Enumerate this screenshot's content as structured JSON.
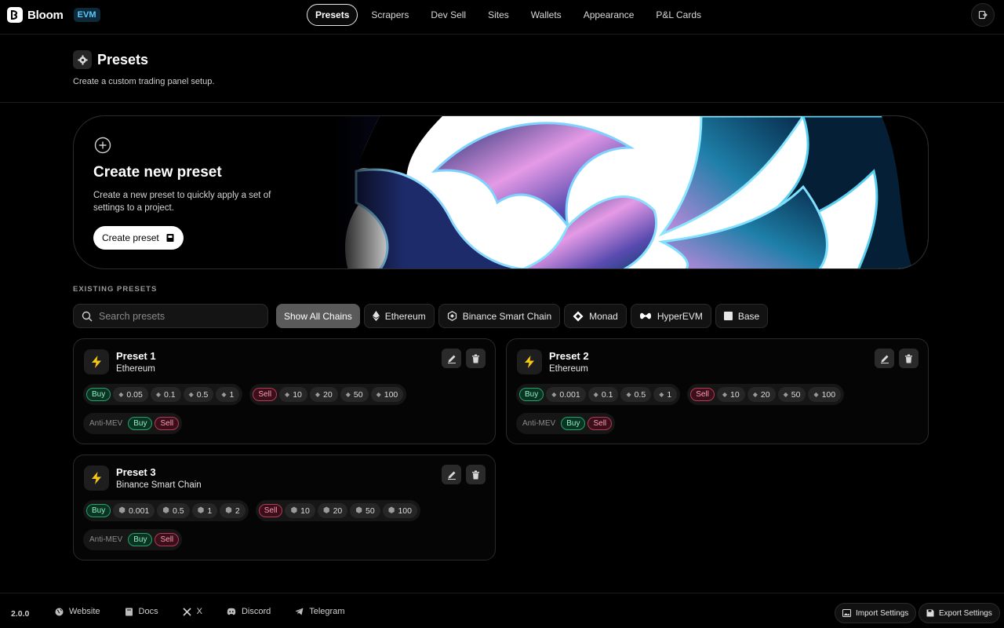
{
  "app": {
    "name": "Bloom",
    "badge": "EVM"
  },
  "nav": [
    "Presets",
    "Scrapers",
    "Dev Sell",
    "Sites",
    "Wallets",
    "Appearance",
    "P&L Cards"
  ],
  "page": {
    "title": "Presets",
    "subtitle": "Create a custom trading panel setup."
  },
  "hero": {
    "title": "Create new preset",
    "description": "Create a new preset to quickly apply a set of settings to a project.",
    "button": "Create preset"
  },
  "existing": {
    "label": "EXISTING PRESETS",
    "search_placeholder": "Search presets",
    "chains": [
      "Show All Chains",
      "Ethereum",
      "Binance Smart Chain",
      "Monad",
      "HyperEVM",
      "Base"
    ]
  },
  "presets": [
    {
      "name": "Preset 1",
      "chain": "Ethereum",
      "buy": [
        "0.05",
        "0.1",
        "0.5",
        "1"
      ],
      "sell": [
        "10",
        "20",
        "50",
        "100"
      ]
    },
    {
      "name": "Preset 2",
      "chain": "Ethereum",
      "buy": [
        "0.001",
        "0.1",
        "0.5",
        "1"
      ],
      "sell": [
        "10",
        "20",
        "50",
        "100"
      ]
    },
    {
      "name": "Preset 3",
      "chain": "Binance Smart Chain",
      "buy": [
        "0.001",
        "0.5",
        "1",
        "2"
      ],
      "sell": [
        "10",
        "20",
        "50",
        "100"
      ]
    }
  ],
  "labels": {
    "buy": "Buy",
    "sell": "Sell",
    "antimev": "Anti-MEV"
  },
  "footer": {
    "version": "2.0.0",
    "links": [
      "Website",
      "Docs",
      "X",
      "Discord",
      "Telegram"
    ],
    "import": "Import Settings",
    "export": "Export Settings"
  },
  "colors": {
    "buy": "#8ef0bd",
    "sell": "#ff9ab0",
    "badge": "#5cc8ff"
  }
}
